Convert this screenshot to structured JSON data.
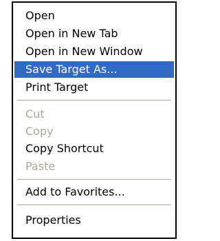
{
  "context_menu": {
    "items": [
      {
        "label": "Open",
        "state": "normal"
      },
      {
        "label": "Open in New Tab",
        "state": "normal"
      },
      {
        "label": "Open in New Window",
        "state": "normal"
      },
      {
        "label": "Save Target As...",
        "state": "selected"
      },
      {
        "label": "Print Target",
        "state": "normal"
      },
      {
        "label": "Cut",
        "state": "disabled"
      },
      {
        "label": "Copy",
        "state": "disabled"
      },
      {
        "label": "Copy Shortcut",
        "state": "normal"
      },
      {
        "label": "Paste",
        "state": "disabled"
      },
      {
        "label": "Add to Favorites...",
        "state": "normal"
      },
      {
        "label": "Properties",
        "state": "normal"
      }
    ]
  },
  "colors": {
    "highlight": "#316ac5",
    "highlight_text": "#ffffff",
    "disabled_text": "#aca899",
    "separator": "#aca899",
    "border": "#000000"
  }
}
